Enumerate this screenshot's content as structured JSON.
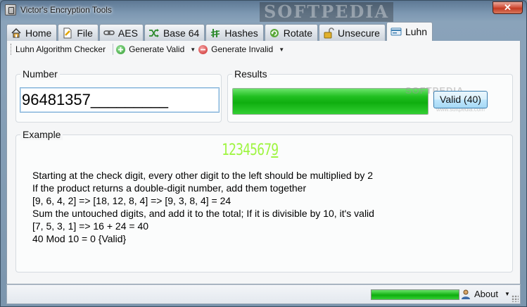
{
  "window": {
    "title": "Victor's Encryption Tools",
    "close_label": "✕",
    "watermark": "SOFTPEDIA"
  },
  "tabs": [
    {
      "label": "Home",
      "icon": "home-icon",
      "active": false
    },
    {
      "label": "File",
      "icon": "file-icon",
      "active": false
    },
    {
      "label": "AES",
      "icon": "chain-link-icon",
      "active": false
    },
    {
      "label": "Base 64",
      "icon": "shuffle-icon",
      "active": false
    },
    {
      "label": "Hashes",
      "icon": "hash-icon",
      "active": false
    },
    {
      "label": "Rotate",
      "icon": "rotate-icon",
      "active": false
    },
    {
      "label": "Unsecure",
      "icon": "open-lock-icon",
      "active": false
    },
    {
      "label": "Luhn",
      "icon": "card-icon",
      "active": true
    }
  ],
  "toolbar": {
    "title": "Luhn Algorithm Checker",
    "generate_valid": "Generate Valid",
    "generate_invalid": "Generate Invalid"
  },
  "number_group": {
    "label": "Number",
    "value": "96481357_________"
  },
  "results_group": {
    "label": "Results",
    "progress": 1.0,
    "button_label": "Valid (40)",
    "watermark": "SOFTPEDIA",
    "watermark_small": "www.softpedia.com"
  },
  "example_group": {
    "label": "Example",
    "digits": "1234567",
    "check_digit": "9",
    "lines": [
      "Starting at the check digit, every other digit to the left should be multiplied by 2",
      "If the product returns a double-digit number, add them together",
      "[9, 6, 4, 2] => [18, 12, 8, 4] => [9, 3, 8, 4] = 24",
      "Sum the untouched digits, and add it to the total; If it is divisible by 10, it's valid",
      "[7, 5, 3, 1] => 16 + 24 = 40",
      "40 Mod 10 = 0 {Valid}"
    ]
  },
  "statusbar": {
    "progress": 1.0,
    "about_label": "About"
  },
  "colors": {
    "progress_green": "#0fae0f",
    "luhn_digits": "#9ff542",
    "accent_blue": "#3c7fb1"
  }
}
